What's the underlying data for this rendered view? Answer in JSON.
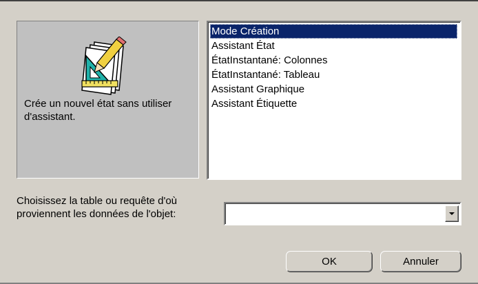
{
  "preview": {
    "icon": "report-design-icon",
    "description": "Crée un nouvel état sans utiliser d'assistant."
  },
  "report_types": {
    "selected_index": 0,
    "items": [
      "Mode Création",
      "Assistant État",
      "ÉtatInstantané:  Colonnes",
      "ÉtatInstantané:  Tableau",
      "Assistant Graphique",
      "Assistant Étiquette"
    ]
  },
  "source": {
    "label": "Choisissez la table ou requête d'où proviennent les données de l'objet:",
    "value": ""
  },
  "buttons": {
    "ok_label": "OK",
    "cancel_label": "Annuler"
  }
}
